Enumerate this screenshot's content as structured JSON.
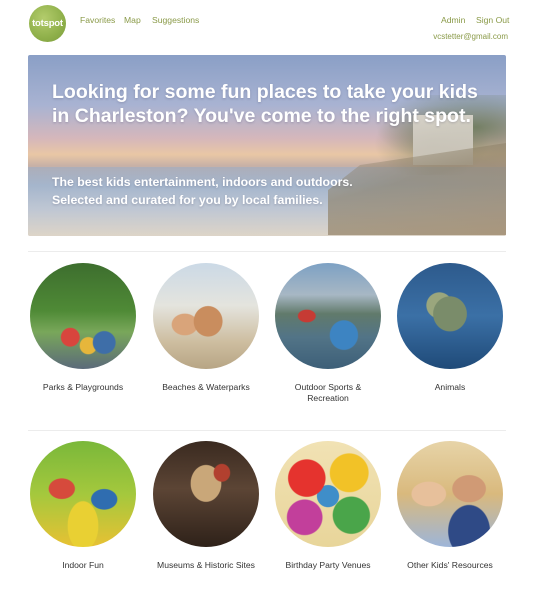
{
  "header": {
    "logo_text": "totspot",
    "nav": [
      "Favorites",
      "Map",
      "Suggestions"
    ],
    "admin": "Admin",
    "sign_out": "Sign Out",
    "email": "vcstetter@gmail.com"
  },
  "hero": {
    "title": "Looking for some fun places to take your kids in Charleston? You've come to the right spot.",
    "subtitle_line1": "The best kids entertainment, indoors and outdoors.",
    "subtitle_line2": "Selected and curated for you by local families."
  },
  "categories": [
    {
      "label": "Parks & Playgrounds",
      "icon": "playground-photo"
    },
    {
      "label": "Beaches & Waterparks",
      "icon": "beach-photo"
    },
    {
      "label": "Outdoor Sports & Recreation",
      "icon": "kayak-photo"
    },
    {
      "label": "Animals",
      "icon": "sea-turtle-photo"
    },
    {
      "label": "Indoor Fun",
      "icon": "indoor-play-photo"
    },
    {
      "label": "Museums & Historic Sites",
      "icon": "museum-photo"
    },
    {
      "label": "Birthday Party Venues",
      "icon": "balloons-photo"
    },
    {
      "label": "Other Kids' Resources",
      "icon": "kids-reading-photo"
    }
  ],
  "colors": {
    "brand": "#8fb04a",
    "nav_link": "#8a9a48",
    "hero_text": "#ffffff"
  }
}
